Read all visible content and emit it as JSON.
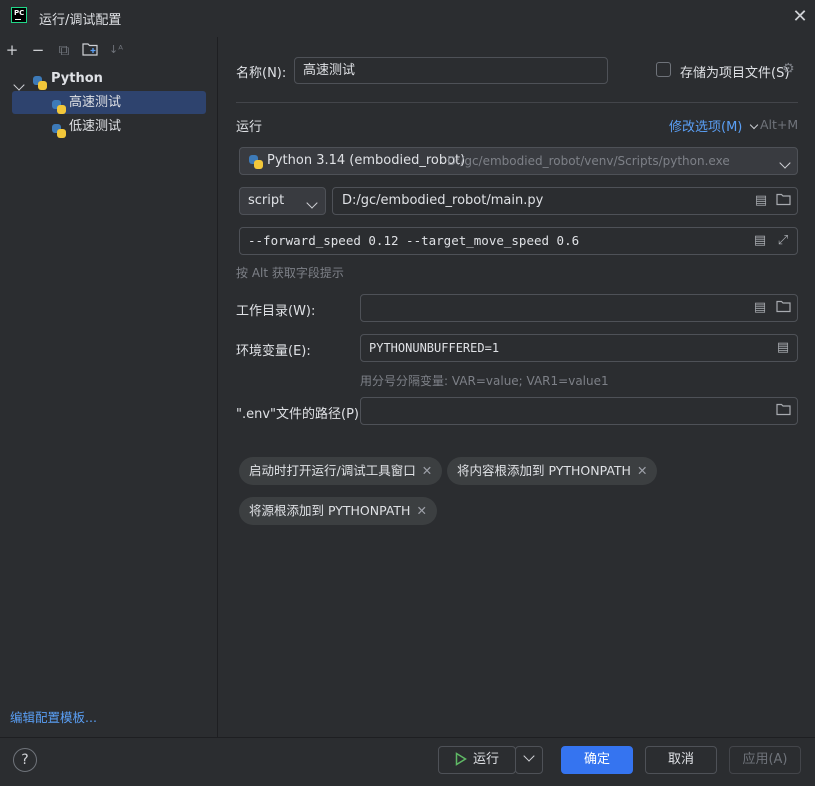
{
  "window": {
    "title": "运行/调试配置",
    "logo_text": "PC"
  },
  "tree": {
    "root_label": "Python",
    "children": [
      "高速测试",
      "低速测试"
    ],
    "edit_templates_link": "编辑配置模板..."
  },
  "form": {
    "name_label": "名称(N):",
    "name_value": "高速测试",
    "store_as_file_label": "存储为项目文件(S)",
    "store_as_file_checked": false,
    "run_section_title": "运行",
    "modify_options_label": "修改选项(M)",
    "modify_options_shortcut": "Alt+M",
    "interpreter_name": "Python 3.14 (embodied_robot)",
    "interpreter_path": "D:/gc/embodied_robot/venv/Scripts/python.exe",
    "target_type": "script",
    "script_path": "D:/gc/embodied_robot/main.py",
    "parameters": "--forward_speed 0.12 --target_move_speed 0.6",
    "alt_hint": "按 Alt 获取字段提示",
    "working_dir_label": "工作目录(W):",
    "working_dir_value": "",
    "env_vars_label": "环境变量(E):",
    "env_vars_value": "PYTHONUNBUFFERED=1",
    "env_hint": "用分号分隔变量: VAR=value; VAR1=value1",
    "env_file_label": "\".env\"文件的路径(P):",
    "env_file_value": "",
    "chips": [
      "启动时打开运行/调试工具窗口",
      "将内容根添加到 PYTHONPATH",
      "将源根添加到 PYTHONPATH"
    ]
  },
  "footer": {
    "help_label": "?",
    "run_label": "运行",
    "ok_label": "确定",
    "cancel_label": "取消",
    "apply_label": "应用(A)"
  },
  "colors": {
    "accent": "#3574f0",
    "link": "#5a9ff5",
    "selection": "#2e436e"
  }
}
